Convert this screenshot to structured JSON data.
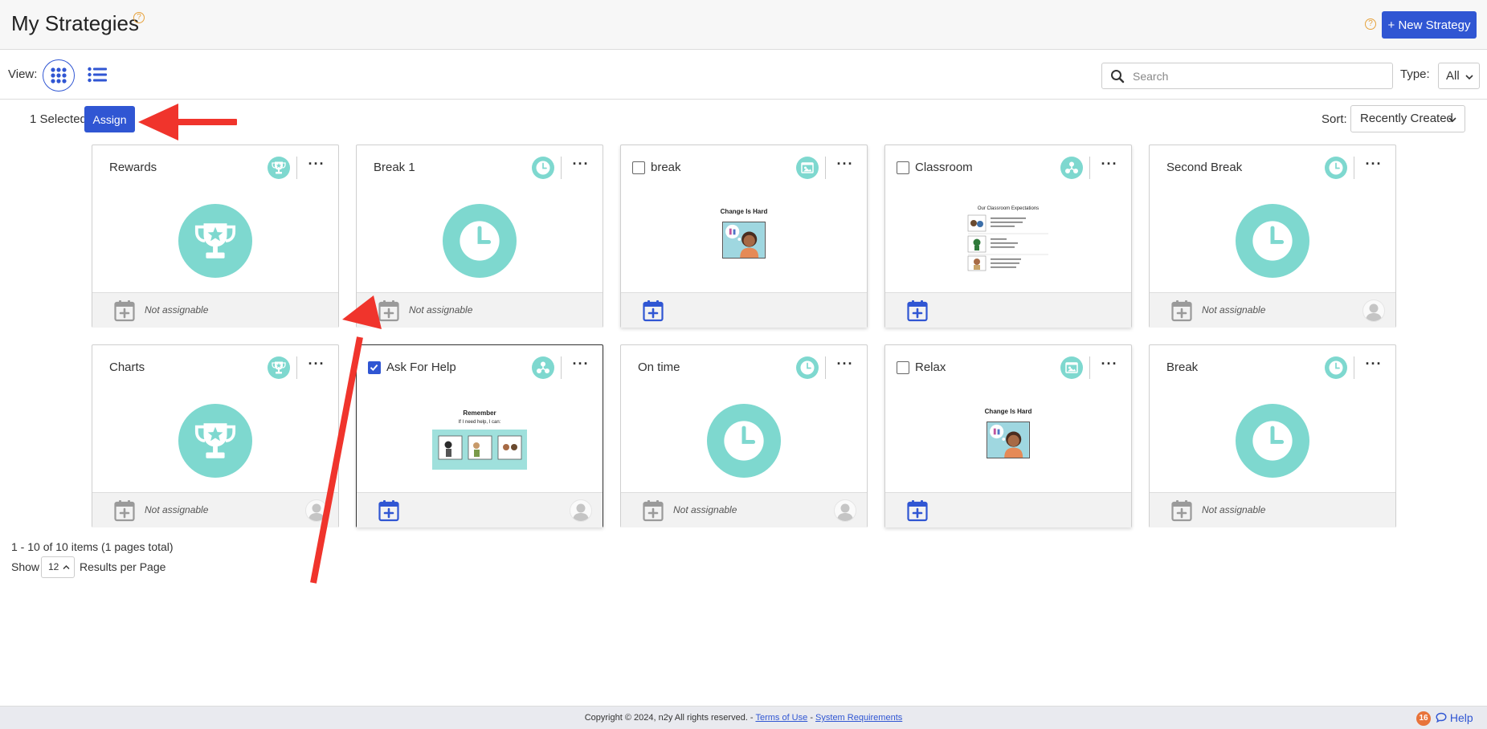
{
  "header": {
    "title": "My Strategies",
    "title_help": "?",
    "header_help": "?",
    "new_button": "+ New Strategy"
  },
  "toolbar": {
    "view_label": "View:",
    "search_placeholder": "Search",
    "type_label": "Type:",
    "type_value": "All"
  },
  "selection": {
    "selected_text": "1 Selected",
    "assign_label": "Assign"
  },
  "sort": {
    "label": "Sort:",
    "value": "Recently Created"
  },
  "cards": [
    {
      "title": "Rewards",
      "type_icon": "trophy-icon",
      "selectable": false,
      "checked": false,
      "assignable": false,
      "status": "Not assignable",
      "avatar": false,
      "image": "trophy-icon"
    },
    {
      "title": "Break 1",
      "type_icon": "clock-icon",
      "selectable": false,
      "checked": false,
      "assignable": false,
      "status": "Not assignable",
      "avatar": false,
      "image": "clock-icon"
    },
    {
      "title": "break",
      "type_icon": "picture-icon",
      "selectable": true,
      "checked": false,
      "assignable": true,
      "status": "",
      "avatar": false,
      "image": "story-thumbnail",
      "thumb_title": "Change Is Hard"
    },
    {
      "title": "Classroom",
      "type_icon": "network-icon",
      "selectable": true,
      "checked": false,
      "assignable": true,
      "status": "",
      "avatar": false,
      "image": "list-thumbnail",
      "thumb_title": "Our Classroom Expectations"
    },
    {
      "title": "Second Break",
      "type_icon": "clock-icon",
      "selectable": false,
      "checked": false,
      "assignable": false,
      "status": "Not assignable",
      "avatar": true,
      "image": "clock-icon"
    },
    {
      "title": "Charts",
      "type_icon": "trophy-icon",
      "selectable": false,
      "checked": false,
      "assignable": false,
      "status": "Not assignable",
      "avatar": true,
      "image": "trophy-icon"
    },
    {
      "title": "Ask For Help",
      "type_icon": "network-icon",
      "selectable": true,
      "checked": true,
      "assignable": true,
      "status": "",
      "avatar": true,
      "image": "help-thumbnail",
      "thumb_title": "Remember",
      "thumb_subtitle": "If I need help, I can:"
    },
    {
      "title": "On time",
      "type_icon": "clock-icon",
      "selectable": false,
      "checked": false,
      "assignable": false,
      "status": "Not assignable",
      "avatar": true,
      "image": "clock-icon"
    },
    {
      "title": "Relax",
      "type_icon": "picture-icon",
      "selectable": true,
      "checked": false,
      "assignable": true,
      "status": "",
      "avatar": false,
      "image": "story-thumbnail",
      "thumb_title": "Change Is Hard"
    },
    {
      "title": "Break",
      "type_icon": "clock-icon",
      "selectable": false,
      "checked": false,
      "assignable": false,
      "status": "Not assignable",
      "avatar": false,
      "image": "clock-icon"
    }
  ],
  "pagination": {
    "summary": "1 - 10 of 10 items (1 pages total)",
    "show_label": "Show",
    "per_page": "12",
    "results_label": "Results per Page"
  },
  "footer": {
    "copyright": "Copyright © 2024, n2y All rights reserved. -",
    "separator": "-",
    "terms": "Terms of Use",
    "system": "System Requirements",
    "notification_count": "16",
    "help": "Help"
  },
  "colors": {
    "primary": "#3056d3",
    "teal": "#7ed8cf",
    "annotation_red": "#f0342c"
  }
}
